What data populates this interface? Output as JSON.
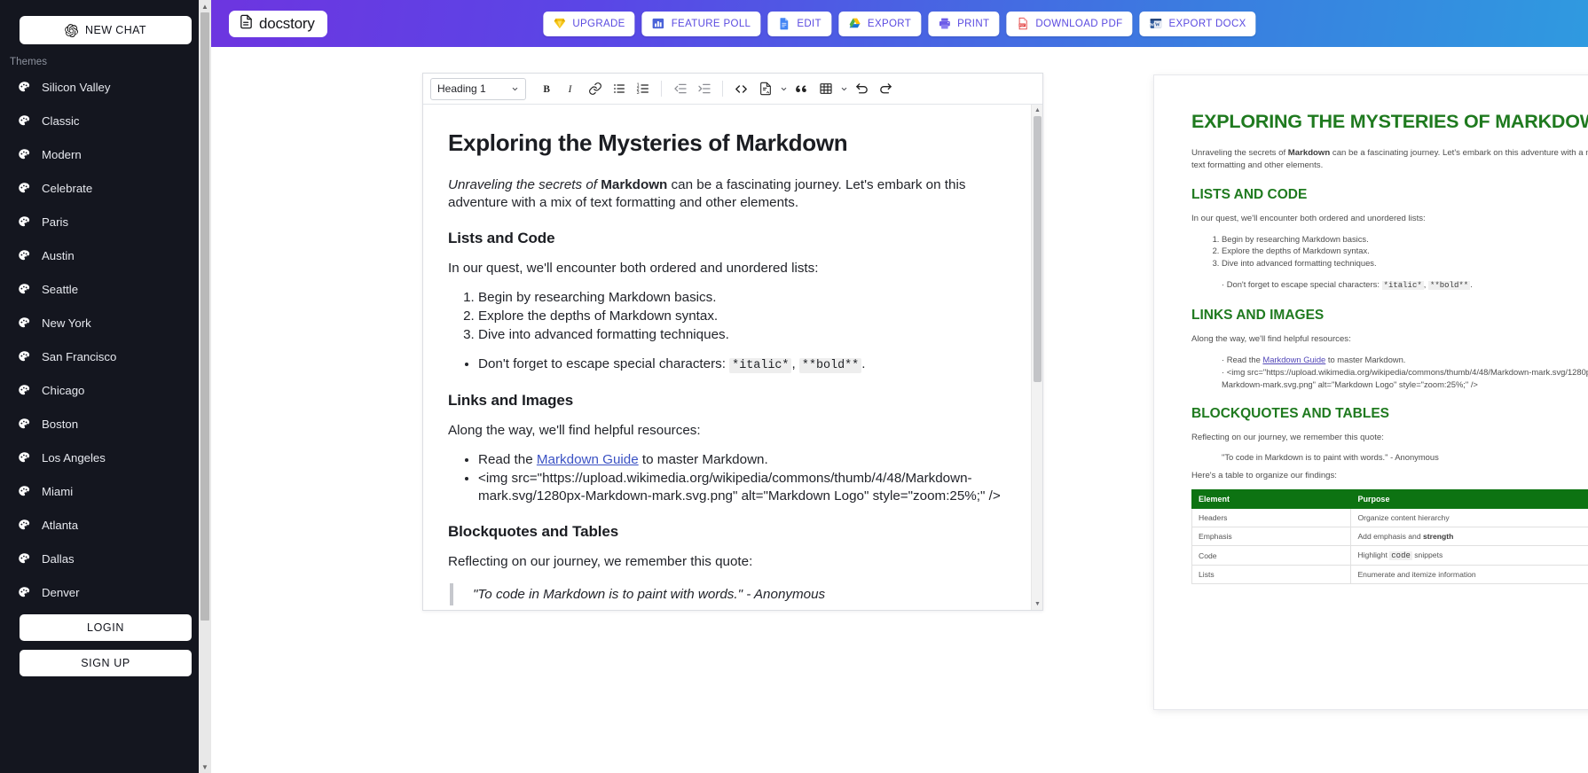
{
  "sidebar": {
    "new_chat_label": "NEW CHAT",
    "themes_label": "Themes",
    "themes": [
      {
        "label": "Silicon Valley"
      },
      {
        "label": "Classic"
      },
      {
        "label": "Modern"
      },
      {
        "label": "Celebrate"
      },
      {
        "label": "Paris"
      },
      {
        "label": "Austin"
      },
      {
        "label": "Seattle"
      },
      {
        "label": "New York"
      },
      {
        "label": "San Francisco"
      },
      {
        "label": "Chicago"
      },
      {
        "label": "Boston"
      },
      {
        "label": "Los Angeles"
      },
      {
        "label": "Miami"
      },
      {
        "label": "Atlanta"
      },
      {
        "label": "Dallas"
      },
      {
        "label": "Denver"
      }
    ],
    "login_label": "LOGIN",
    "signup_label": "SIGN UP"
  },
  "topbar": {
    "brand": "docstory",
    "actions": [
      {
        "label": "UPGRADE",
        "icon": "diamond-icon"
      },
      {
        "label": "FEATURE POLL",
        "icon": "bar-chart-icon"
      },
      {
        "label": "EDIT",
        "icon": "google-docs-icon"
      },
      {
        "label": "EXPORT",
        "icon": "google-drive-icon"
      },
      {
        "label": "PRINT",
        "icon": "printer-icon"
      },
      {
        "label": "DOWNLOAD PDF",
        "icon": "pdf-icon"
      },
      {
        "label": "EXPORT DOCX",
        "icon": "word-icon"
      }
    ],
    "accent": "#5a4ae0"
  },
  "editor_toolbar": {
    "block_style": "Heading 1",
    "buttons": [
      {
        "name": "bold",
        "glyph": "B"
      },
      {
        "name": "italic",
        "glyph": "I"
      },
      {
        "name": "link",
        "glyph": "link"
      },
      {
        "name": "bullet-list",
        "glyph": "ul"
      },
      {
        "name": "ordered-list",
        "glyph": "ol"
      },
      {
        "name": "outdent",
        "glyph": "outdent"
      },
      {
        "name": "indent",
        "glyph": "indent"
      },
      {
        "name": "code-block",
        "glyph": "<>"
      },
      {
        "name": "insert-template",
        "glyph": "doc"
      },
      {
        "name": "blockquote",
        "glyph": "quote"
      },
      {
        "name": "table",
        "glyph": "table"
      },
      {
        "name": "undo",
        "glyph": "undo"
      },
      {
        "name": "redo",
        "glyph": "redo"
      }
    ]
  },
  "document": {
    "title": "Exploring the Mysteries of Markdown",
    "intro_italic": "Unraveling the secrets of ",
    "intro_bold": "Markdown",
    "intro_rest": " can be a fascinating journey. Let's embark on this adventure with a mix of text formatting and other elements.",
    "h2_lists": "Lists and Code",
    "lists_intro": "In our quest, we'll encounter both ordered and unordered lists:",
    "ordered": [
      "Begin by researching Markdown basics.",
      "Explore the depths of Markdown syntax.",
      "Dive into advanced formatting techniques."
    ],
    "escape_prefix": "Don't forget to escape special characters: ",
    "code_italic": "*italic*",
    "code_sep": ", ",
    "code_bold": "**bold**",
    "code_end": ".",
    "h2_links": "Links and Images",
    "links_intro": "Along the way, we'll find helpful resources:",
    "link_prefix": "Read the ",
    "link_text": "Markdown Guide",
    "link_suffix": " to master Markdown.",
    "img_tag": "<img src=\"https://upload.wikimedia.org/wikipedia/commons/thumb/4/48/Markdown-mark.svg/1280px-Markdown-mark.svg.png\" alt=\"Markdown Logo\" style=\"zoom:25%;\" />",
    "h2_blockquotes": "Blockquotes and Tables",
    "blockquote_intro": "Reflecting on our journey, we remember this quote:",
    "blockquote": "\"To code in Markdown is to paint with words.\" - Anonymous"
  },
  "preview": {
    "title": "EXPLORING THE MYSTERIES OF MARKDOWN",
    "h2_lists": "LISTS AND CODE",
    "h2_links": "LINKS AND IMAGES",
    "h2_blockquotes": "BLOCKQUOTES AND TABLES",
    "table_intro": "Here's a table to organize our findings:",
    "table": {
      "headers": [
        "Element",
        "Purpose"
      ],
      "rows": [
        {
          "element": "Headers",
          "purpose_pre": "Organize content hierarchy",
          "purpose_code": "",
          "purpose_post": "",
          "purpose_bold": ""
        },
        {
          "element": "Emphasis",
          "purpose_pre": "Add emphasis and ",
          "purpose_bold": "strength",
          "purpose_code": "",
          "purpose_post": ""
        },
        {
          "element": "Code",
          "purpose_pre": "Highlight ",
          "purpose_code": "code",
          "purpose_post": " snippets",
          "purpose_bold": ""
        },
        {
          "element": "Lists",
          "purpose_pre": "Enumerate and itemize information",
          "purpose_code": "",
          "purpose_post": "",
          "purpose_bold": ""
        }
      ]
    },
    "header_bg": "#0d7312",
    "heading_color": "#1f7a1f"
  }
}
